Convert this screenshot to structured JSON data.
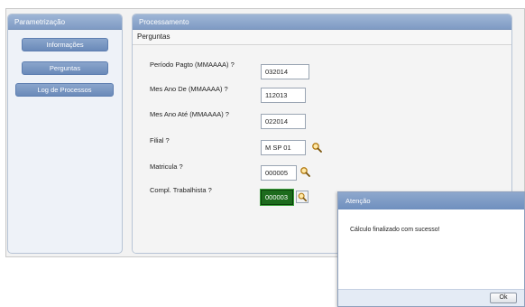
{
  "left_panel": {
    "header": "Parametrização",
    "buttons": [
      "Informações",
      "Perguntas",
      "Log de Processos"
    ]
  },
  "main_panel": {
    "header": "Processamento",
    "subheader": "Perguntas",
    "fields": [
      {
        "label": "Período Pagto (MMAAAA) ?",
        "value": "032014"
      },
      {
        "label": "Mes Ano De (MMAAAA) ?",
        "value": "112013"
      },
      {
        "label": "Mes Ano Até (MMAAAA) ?",
        "value": "022014"
      },
      {
        "label": "Filial ?",
        "value": "M SP 01"
      },
      {
        "label": "Matricula ?",
        "value": "000005"
      },
      {
        "label": "Compl. Trabalhista ?",
        "value": "000003"
      }
    ]
  },
  "dialog": {
    "title": "Atenção",
    "message": "Cálculo finalizado com sucesso!",
    "ok_label": "Ok"
  },
  "icons": {
    "lookup": "magnifier-icon"
  },
  "colors": {
    "header_blue": "#8ea8cd",
    "selected_field": "#1d6b1d"
  }
}
